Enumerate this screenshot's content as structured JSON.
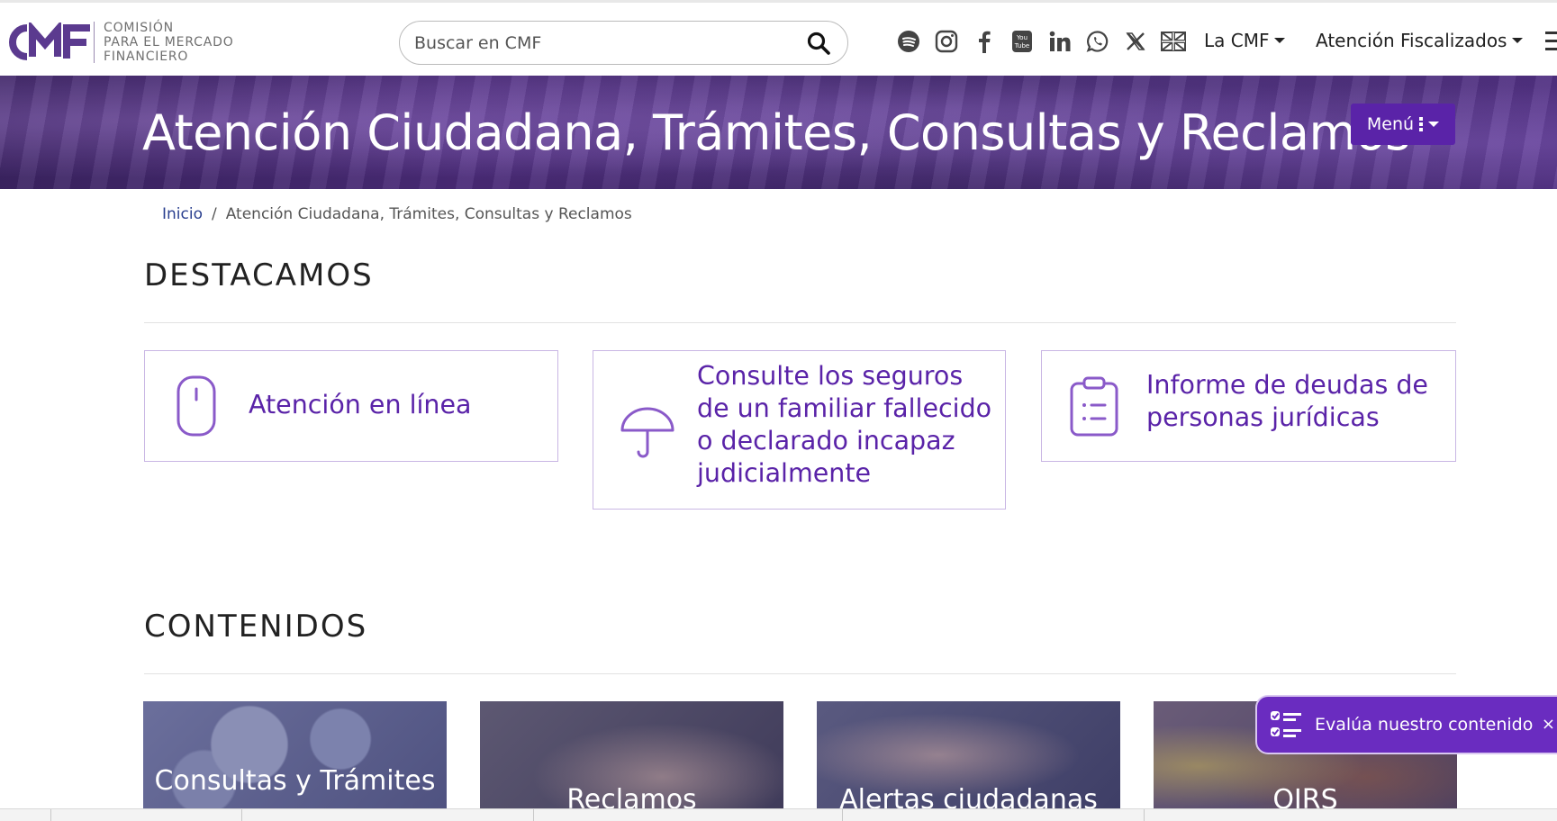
{
  "header": {
    "logo": {
      "mark": "CMF",
      "line1": "COMISIÓN",
      "line2": "PARA EL MERCADO",
      "line3": "FINANCIERO"
    },
    "search": {
      "placeholder": "Buscar en CMF",
      "icon": "search-icon"
    },
    "social_icons": [
      "spotify-icon",
      "instagram-icon",
      "facebook-icon",
      "youtube-icon",
      "linkedin-icon",
      "whatsapp-icon",
      "x-icon",
      "english-flag-icon"
    ],
    "nav": {
      "la_cmf": "La CMF",
      "atencion_fiscalizados": "Atención Fiscalizados"
    }
  },
  "banner": {
    "title": "Atención Ciudadana, Trámites, Consultas y Reclamos",
    "menu_label": "Menú"
  },
  "breadcrumb": {
    "home": "Inicio",
    "separator": "/",
    "current": "Atención Ciudadana, Trámites, Consultas y Reclamos"
  },
  "destacamos": {
    "title": "DESTACAMOS",
    "cards": [
      {
        "label": "Atención en línea",
        "icon": "mouse-icon"
      },
      {
        "label": "Consulte los seguros de un familiar fallecido o declarado incapaz judicialmente",
        "icon": "umbrella-icon"
      },
      {
        "label": "Informe de deudas de personas jurídicas",
        "icon": "clipboard-icon"
      }
    ]
  },
  "contenidos": {
    "title": "CONTENIDOS",
    "tiles": [
      {
        "label": "Consultas y Trámites"
      },
      {
        "label": "Reclamos"
      },
      {
        "label": "Alertas ciudadanas"
      },
      {
        "label": "OIRS"
      }
    ]
  },
  "feedback": {
    "label": "Evalúa nuestro contenido",
    "close": "×"
  },
  "colors": {
    "brand_purple": "#5a23a8",
    "banner_purple": "#4a2b78",
    "breadcrumb_link": "#2a3f8f"
  }
}
